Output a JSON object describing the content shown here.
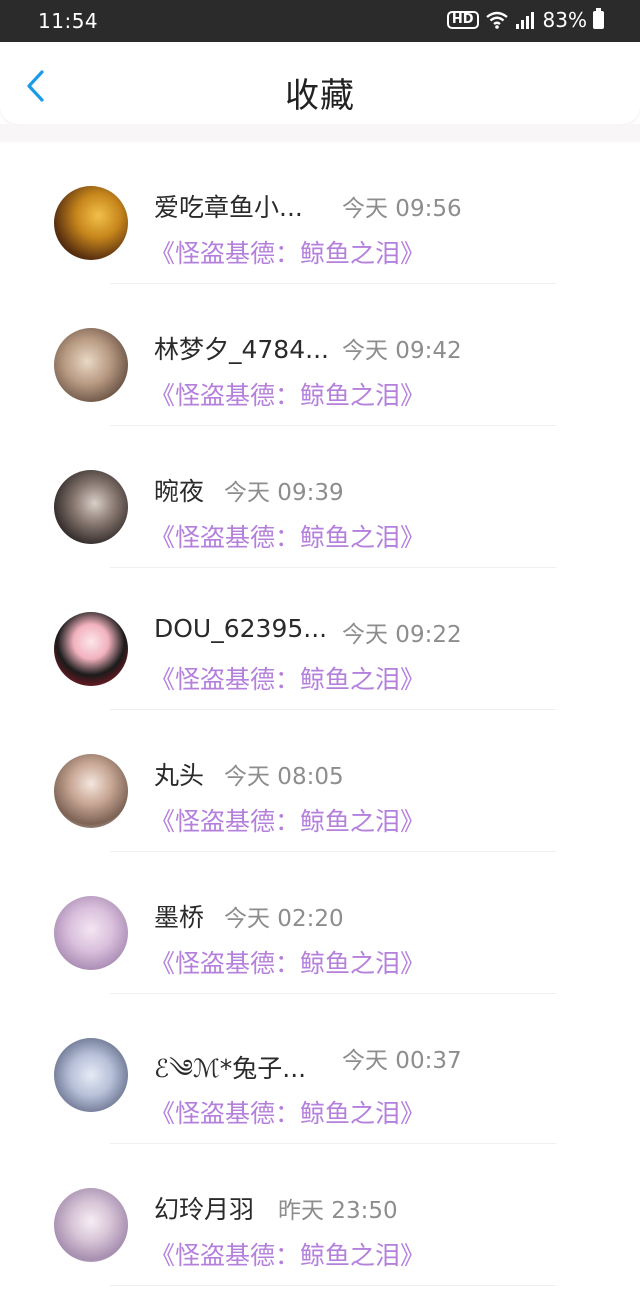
{
  "status_bar": {
    "time": "11:54",
    "hd": "HD",
    "battery": "83%",
    "icons": [
      "wifi-icon",
      "signal-icon",
      "battery-icon"
    ]
  },
  "navbar": {
    "title": "收藏",
    "back_icon": "chevron-left-icon",
    "accent": "#1a9be8"
  },
  "items": [
    {
      "name": "爱吃章鱼小...",
      "time": "今天 09:56",
      "work": "《怪盗基德：鲸鱼之泪》"
    },
    {
      "name": "林梦夕_4784...",
      "time": "今天 09:42",
      "work": "《怪盗基德：鲸鱼之泪》"
    },
    {
      "name": "晼夜",
      "time": "今天 09:39",
      "work": "《怪盗基德：鲸鱼之泪》"
    },
    {
      "name": "DOU_62395...",
      "time": "今天 09:22",
      "work": "《怪盗基德：鲸鱼之泪》"
    },
    {
      "name": "丸头",
      "time": "今天 08:05",
      "work": "《怪盗基德：鲸鱼之泪》"
    },
    {
      "name": "墨桥",
      "time": "今天 02:20",
      "work": "《怪盗基德：鲸鱼之泪》"
    },
    {
      "name": "ℰ༄ℳ*兔子...",
      "time": "今天 00:37",
      "work": "《怪盗基德：鲸鱼之泪》"
    },
    {
      "name": "幻玲月羽",
      "time": "昨天 23:50",
      "work": "《怪盗基德：鲸鱼之泪》"
    }
  ],
  "colors": {
    "work_title": "#b480dc",
    "time_text": "#8d8d8d",
    "name_text": "#2a2a2a"
  }
}
